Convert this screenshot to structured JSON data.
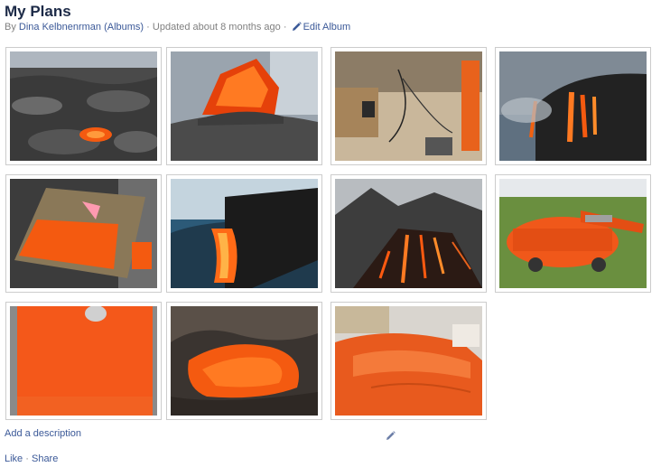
{
  "album": {
    "title": "My Plans",
    "by_label": "By",
    "owner_name": "Dina Kelbnenrman",
    "albums_link": "(Albums)",
    "separator": "·",
    "updated": "Updated about 8 months ago",
    "edit_album": "Edit Album"
  },
  "photos": [
    {
      "name": "lava-field-photo"
    },
    {
      "name": "lava-mound-photo"
    },
    {
      "name": "workshop-floor-photo"
    },
    {
      "name": "lava-ocean-entry-photo"
    },
    {
      "name": "painted-board-photo"
    },
    {
      "name": "lava-waterfall-photo"
    },
    {
      "name": "volcano-eruption-photo"
    },
    {
      "name": "mower-deck-photo"
    },
    {
      "name": "orange-panel-photo"
    },
    {
      "name": "lava-flow-closeup-photo"
    },
    {
      "name": "orange-car-photo"
    }
  ],
  "footer": {
    "add_description": "Add a description",
    "like": "Like",
    "share": "Share",
    "separator": "·"
  },
  "colors": {
    "link": "#3b5998",
    "title": "#1c2a47",
    "lava": "#f45a10",
    "border": "#cccccc"
  }
}
